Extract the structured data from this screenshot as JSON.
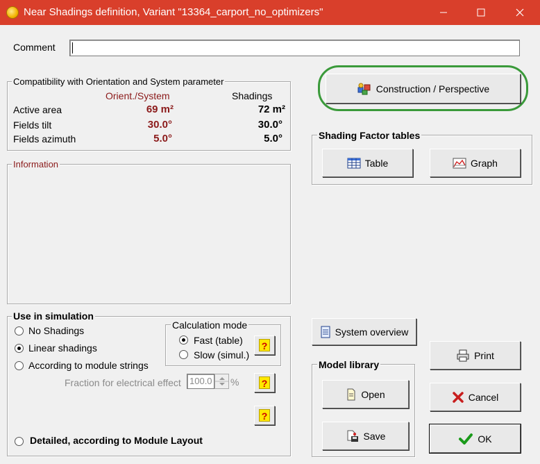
{
  "window": {
    "title": "Near Shadings definition, Variant \"13364_carport_no_optimizers\"",
    "minimize_icon": "minimize-icon",
    "maximize_icon": "maximize-icon",
    "close_icon": "close-icon"
  },
  "comment": {
    "label": "Comment",
    "value": ""
  },
  "compat": {
    "title": "Compatibility with Orientation and System parameter",
    "col_orient": "Orient./System",
    "col_shadings": "Shadings",
    "rows": [
      {
        "label": "Active area",
        "orient": "69 m²",
        "shadings": "72 m²"
      },
      {
        "label": "Fields tilt",
        "orient": "30.0°",
        "shadings": "30.0°"
      },
      {
        "label": "Fields azimuth",
        "orient": "5.0°",
        "shadings": "5.0°"
      }
    ]
  },
  "information": {
    "title": "Information"
  },
  "construction_button": {
    "label": "Construction / Perspective",
    "highlight_color": "#3a9a3a"
  },
  "shading_tables": {
    "title": "Shading Factor tables",
    "table_label": "Table",
    "graph_label": "Graph"
  },
  "simulation": {
    "title": "Use in simulation",
    "options": [
      "No Shadings",
      "Linear shadings",
      "According to module strings"
    ],
    "selected": "Linear shadings",
    "fraction_label": "Fraction for electrical effect",
    "fraction_value": "100.0",
    "fraction_unit": "%",
    "detailed_label": "Detailed, according to Module Layout",
    "calc_mode": {
      "title": "Calculation mode",
      "options": [
        "Fast (table)",
        "Slow (simul.)"
      ],
      "selected": "Fast (table)"
    },
    "help_mark": "?"
  },
  "system_overview": {
    "label": "System overview"
  },
  "model_library": {
    "title": "Model library",
    "open_label": "Open",
    "save_label": "Save"
  },
  "actions": {
    "print_label": "Print",
    "cancel_label": "Cancel",
    "ok_label": "OK"
  }
}
